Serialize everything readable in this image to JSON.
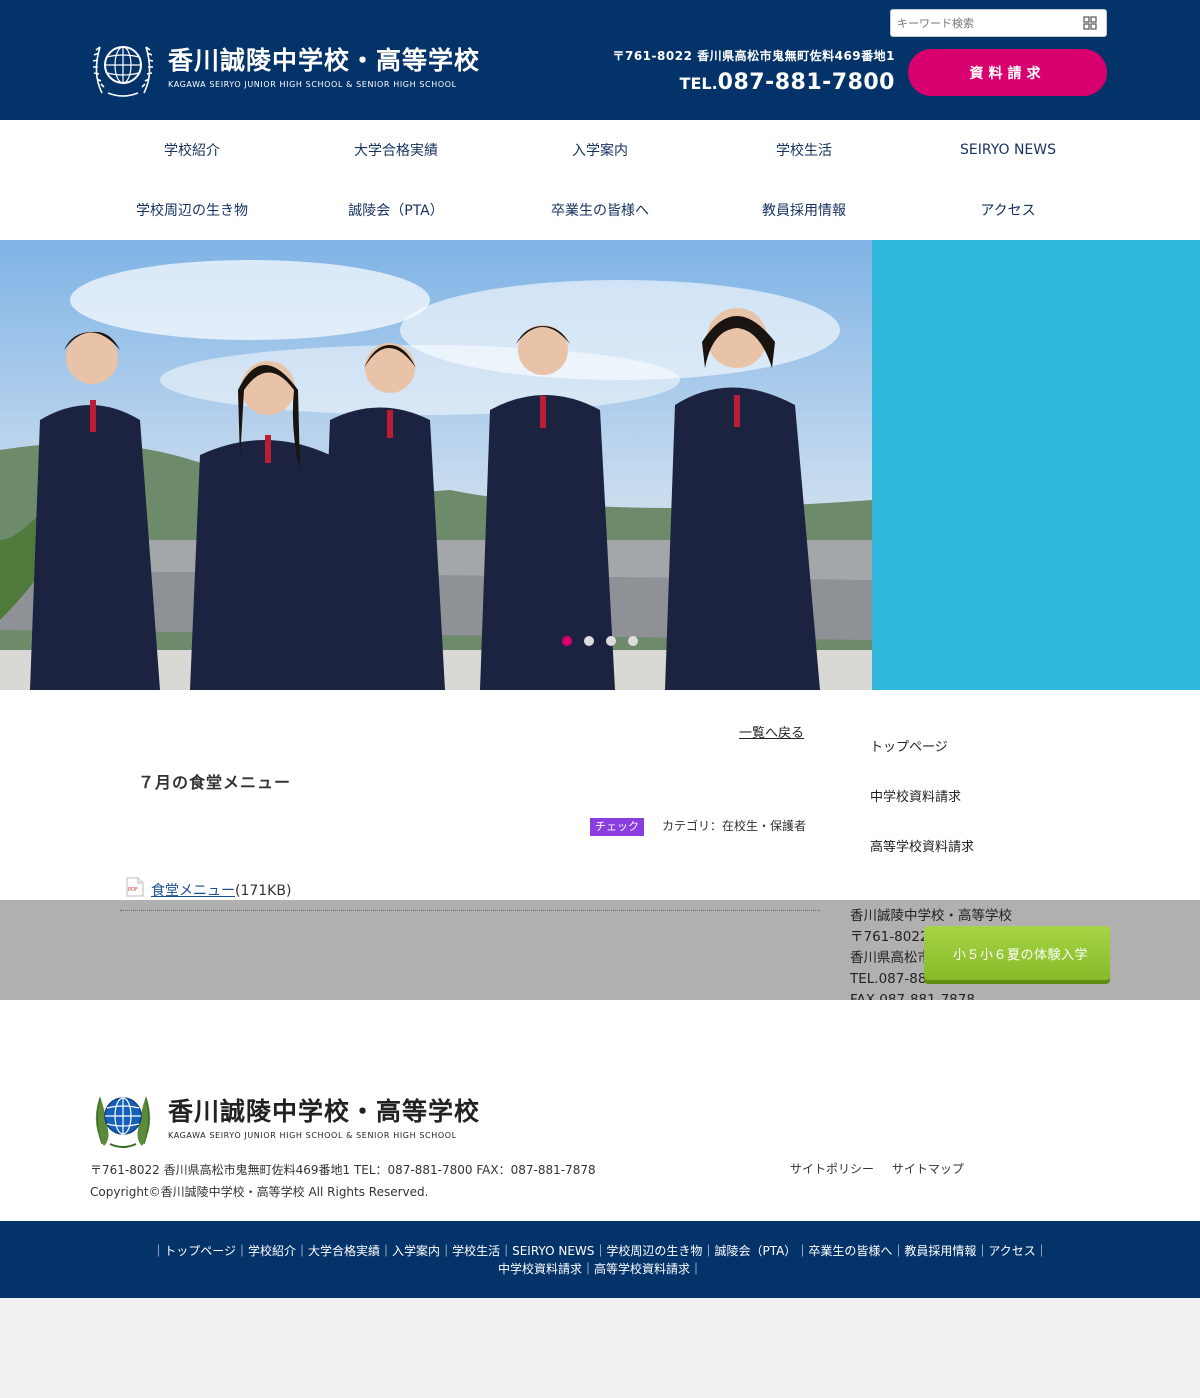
{
  "header": {
    "school_name_jp": "香川誠陵中学校・高等学校",
    "school_name_en": "KAGAWA SEIRYO JUNIOR HIGH SCHOOL & SENIOR HIGH SCHOOL",
    "search_placeholder": "キーワード検索",
    "address": "〒761-8022 香川県高松市鬼無町佐料469番地1",
    "tel_prefix": "TEL.",
    "tel_number": "087-881-7800",
    "request_button": "資料請求",
    "colors": {
      "header_bg": "#04336a",
      "accent": "#d8006e",
      "hero_side": "#30b9dd"
    }
  },
  "nav": {
    "row1": [
      "学校紹介",
      "大学合格実績",
      "入学案内",
      "学校生活",
      "SEIRYO NEWS"
    ],
    "row2": [
      "学校周辺の生き物",
      "誠陵会（PTA）",
      "卒業生の皆様へ",
      "教員採用情報",
      "アクセス"
    ]
  },
  "hero": {
    "slide_count": 4,
    "active_slide": 1
  },
  "post": {
    "back_icon": "",
    "back_label": "一覧へ戻る",
    "title": "７月の食堂メニュー",
    "badge": "チェック",
    "category": "カテゴリ：在校生・保護者",
    "pdf_icon_text": "PDF",
    "file_label": "食堂メニュー",
    "file_size": "(171KB)"
  },
  "sidebar": {
    "links": [
      "トップページ",
      "中学校資料請求",
      "高等学校資料請求"
    ],
    "contact": {
      "name": "香川誠陵中学校・高等学校",
      "postal": "〒761-8022",
      "address": "香川県高松市",
      "tel": "TEL.087-881-7800",
      "fax": "FAX.087-881-7878"
    }
  },
  "trial_button": {
    "icon": "",
    "label": "小５小６夏の体験入学"
  },
  "footer": {
    "school_name_jp": "香川誠陵中学校・高等学校",
    "school_name_en": "KAGAWA SEIRYO JUNIOR HIGH SCHOOL & SENIOR HIGH SCHOOL",
    "address_line": "〒761-8022 香川県高松市鬼無町佐料469番地1 TEL：087-881-7800  FAX：087-881-7878",
    "copyright": "Copyright©香川誠陵中学校・高等学校 All Rights Reserved.",
    "site_policy": " サイトポリシー",
    "sitemap": " サイトマップ"
  },
  "bottom_nav": {
    "row1": [
      "トップページ",
      "学校紹介",
      "大学合格実績",
      "入学案内",
      "学校生活",
      "SEIRYO NEWS",
      "学校周辺の生き物",
      "誠陵会（PTA）",
      "卒業生の皆様へ",
      "教員採用情報",
      "アクセス"
    ],
    "row2": [
      "中学校資料請求",
      "高等学校資料請求"
    ]
  }
}
